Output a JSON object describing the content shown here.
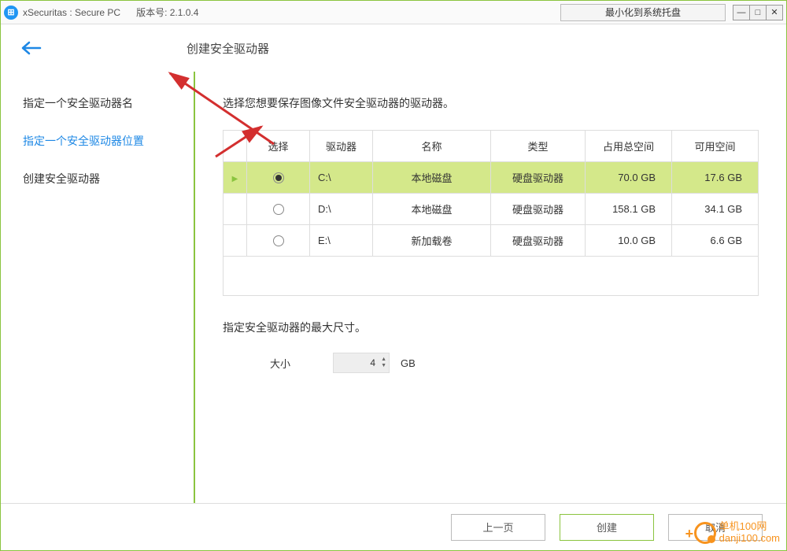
{
  "titlebar": {
    "app_title": "xSecuritas : Secure PC",
    "version_label": "版本号: 2.1.0.4",
    "tray_button": "最小化到系统托盘"
  },
  "header": {
    "page_title": "创建安全驱动器"
  },
  "sidebar": {
    "items": [
      {
        "label": "指定一个安全驱动器名",
        "active": false
      },
      {
        "label": "指定一个安全驱动器位置",
        "active": true
      },
      {
        "label": "创建安全驱动器",
        "active": false
      }
    ]
  },
  "main": {
    "instruction": "选择您想要保存图像文件安全驱动器的驱动器。",
    "table": {
      "headers": [
        "",
        "选择",
        "驱动器",
        "名称",
        "类型",
        "占用总空间",
        "可用空间"
      ],
      "rows": [
        {
          "selected": true,
          "drive": "C:\\",
          "name": "本地磁盘",
          "type": "硬盘驱动器",
          "total": "70.0 GB",
          "free": "17.6 GB"
        },
        {
          "selected": false,
          "drive": "D:\\",
          "name": "本地磁盘",
          "type": "硬盘驱动器",
          "total": "158.1 GB",
          "free": "34.1 GB"
        },
        {
          "selected": false,
          "drive": "E:\\",
          "name": "新加载卷",
          "type": "硬盘驱动器",
          "total": "10.0 GB",
          "free": "6.6 GB"
        }
      ]
    },
    "size": {
      "label": "指定安全驱动器的最大尺寸。",
      "field_label": "大小",
      "value": "4",
      "unit": "GB"
    }
  },
  "footer": {
    "prev": "上一页",
    "create": "创建",
    "cancel": "取消"
  },
  "watermark": {
    "line1": "单机100网",
    "line2": "danji100.com"
  }
}
